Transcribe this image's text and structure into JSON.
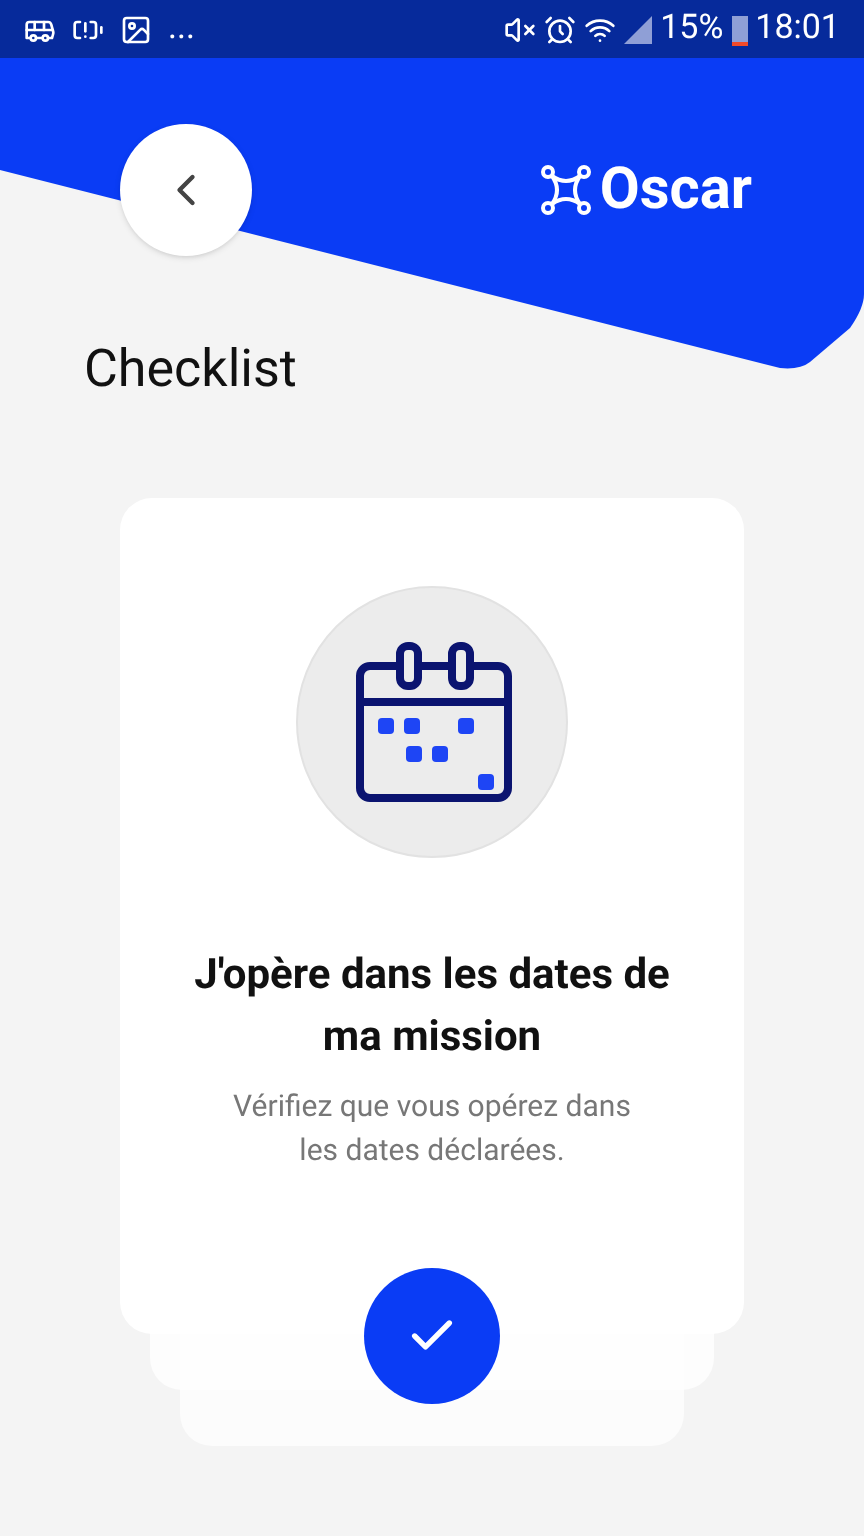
{
  "status_bar": {
    "more": "...",
    "battery": "15%",
    "time": "18:01"
  },
  "header": {
    "logo": "Oscar"
  },
  "title": "Checklist",
  "card": {
    "heading": "J'opère dans les dates de ma mission",
    "text": "Vérifiez que vous opérez dans les dates déclarées."
  }
}
